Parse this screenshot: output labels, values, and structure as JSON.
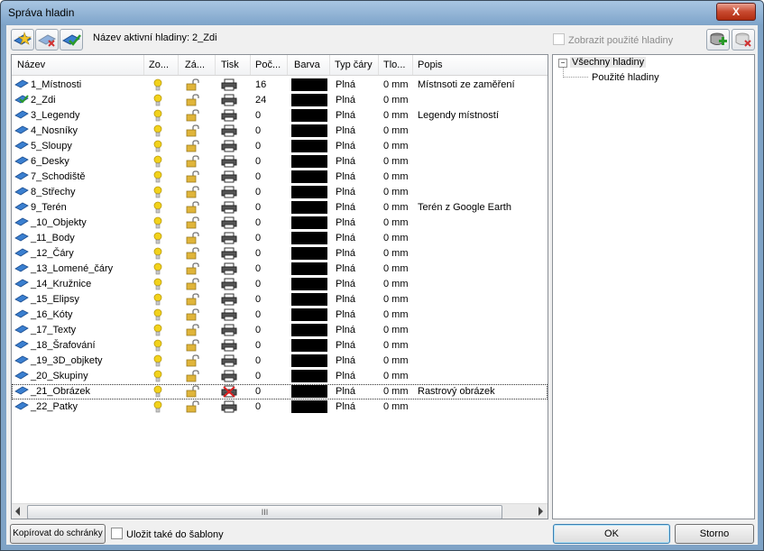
{
  "window": {
    "title": "Správa hladin",
    "close_label": "X"
  },
  "toolbar": {
    "active_layer_text": "Název aktivní hladiny: 2_Zdi",
    "show_used_label": "Zobrazit použité hladiny"
  },
  "table": {
    "columns": [
      "Název",
      "Zo...",
      "Zá...",
      "Tisk",
      "Poč...",
      "Barva",
      "Typ čáry",
      "Tlo...",
      "Popis"
    ],
    "rows": [
      {
        "name": "1_Místnosti",
        "count": "16",
        "linetype": "Plná",
        "thick": "0 mm",
        "desc": "Místnsoti ze zaměření",
        "active": false,
        "print_off": false
      },
      {
        "name": "2_Zdi",
        "count": "24",
        "linetype": "Plná",
        "thick": "0 mm",
        "desc": "",
        "active": true,
        "print_off": false
      },
      {
        "name": "3_Legendy",
        "count": "0",
        "linetype": "Plná",
        "thick": "0 mm",
        "desc": "Legendy místností",
        "active": false,
        "print_off": false
      },
      {
        "name": "4_Nosníky",
        "count": "0",
        "linetype": "Plná",
        "thick": "0 mm",
        "desc": "",
        "active": false,
        "print_off": false
      },
      {
        "name": "5_Sloupy",
        "count": "0",
        "linetype": "Plná",
        "thick": "0 mm",
        "desc": "",
        "active": false,
        "print_off": false
      },
      {
        "name": "6_Desky",
        "count": "0",
        "linetype": "Plná",
        "thick": "0 mm",
        "desc": "",
        "active": false,
        "print_off": false
      },
      {
        "name": "7_Schodiště",
        "count": "0",
        "linetype": "Plná",
        "thick": "0 mm",
        "desc": "",
        "active": false,
        "print_off": false
      },
      {
        "name": "8_Střechy",
        "count": "0",
        "linetype": "Plná",
        "thick": "0 mm",
        "desc": "",
        "active": false,
        "print_off": false
      },
      {
        "name": "9_Terén",
        "count": "0",
        "linetype": "Plná",
        "thick": "0 mm",
        "desc": "Terén z Google Earth",
        "active": false,
        "print_off": false
      },
      {
        "name": "_10_Objekty",
        "count": "0",
        "linetype": "Plná",
        "thick": "0 mm",
        "desc": "",
        "active": false,
        "print_off": false
      },
      {
        "name": "_11_Body",
        "count": "0",
        "linetype": "Plná",
        "thick": "0 mm",
        "desc": "",
        "active": false,
        "print_off": false
      },
      {
        "name": "_12_Čáry",
        "count": "0",
        "linetype": "Plná",
        "thick": "0 mm",
        "desc": "",
        "active": false,
        "print_off": false
      },
      {
        "name": "_13_Lomené_čáry",
        "count": "0",
        "linetype": "Plná",
        "thick": "0 mm",
        "desc": "",
        "active": false,
        "print_off": false
      },
      {
        "name": "_14_Kružnice",
        "count": "0",
        "linetype": "Plná",
        "thick": "0 mm",
        "desc": "",
        "active": false,
        "print_off": false
      },
      {
        "name": "_15_Elipsy",
        "count": "0",
        "linetype": "Plná",
        "thick": "0 mm",
        "desc": "",
        "active": false,
        "print_off": false
      },
      {
        "name": "_16_Kóty",
        "count": "0",
        "linetype": "Plná",
        "thick": "0 mm",
        "desc": "",
        "active": false,
        "print_off": false
      },
      {
        "name": "_17_Texty",
        "count": "0",
        "linetype": "Plná",
        "thick": "0 mm",
        "desc": "",
        "active": false,
        "print_off": false
      },
      {
        "name": "_18_Šrafování",
        "count": "0",
        "linetype": "Plná",
        "thick": "0 mm",
        "desc": "",
        "active": false,
        "print_off": false
      },
      {
        "name": "_19_3D_objkety",
        "count": "0",
        "linetype": "Plná",
        "thick": "0 mm",
        "desc": "",
        "active": false,
        "print_off": false
      },
      {
        "name": "_20_Skupiny",
        "count": "0",
        "linetype": "Plná",
        "thick": "0 mm",
        "desc": "",
        "active": false,
        "print_off": false
      },
      {
        "name": "_21_Obrázek",
        "count": "0",
        "linetype": "Plná",
        "thick": "0 mm",
        "desc": "Rastrový obrázek",
        "active": false,
        "print_off": true
      },
      {
        "name": "_22_Patky",
        "count": "0",
        "linetype": "Plná",
        "thick": "0 mm",
        "desc": "",
        "active": false,
        "print_off": false
      }
    ],
    "selected_row": "_21_Obrázek",
    "swatch_color": "#000000"
  },
  "scrollbar": {
    "grip": "III"
  },
  "tree": {
    "root_toggle": "−",
    "root": "Všechny hladiny",
    "child": "Použité hladiny"
  },
  "footer": {
    "copy_label": "Kopírovat do schránky",
    "save_template_label": "Uložit také do šablony",
    "ok_label": "OK",
    "cancel_label": "Storno"
  },
  "colors": {
    "accent": "#3c7fb1",
    "title_bar": "#8fb2d6",
    "close": "#c84a30",
    "bulb": "#f2d21b",
    "lock": "#e0b53a"
  }
}
